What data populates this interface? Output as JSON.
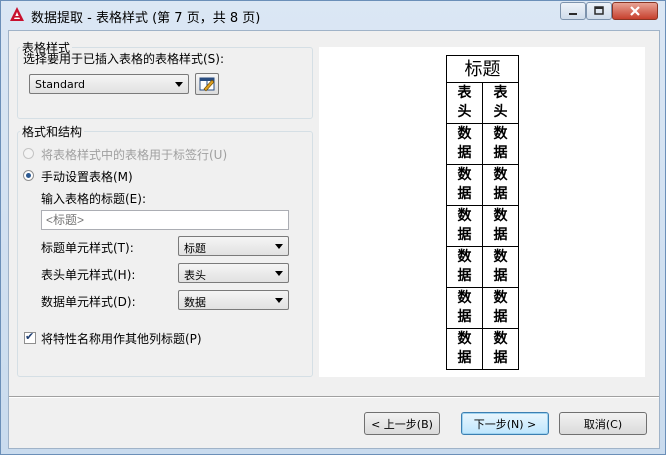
{
  "window": {
    "title": "数据提取 - 表格样式 (第 7 页，共 8 页)"
  },
  "table_style_group": {
    "title": "表格样式",
    "select_label": "选择要用于已插入表格的表格样式(S):",
    "style_value": "Standard"
  },
  "format_group": {
    "title": "格式和结构",
    "radio_label_option": "将表格样式中的表格用于标签行(U)",
    "radio_manual": "手动设置表格(M)",
    "title_input_label": "输入表格的标题(E):",
    "title_input_placeholder": "<标题>",
    "title_cell_label": "标题单元样式(T):",
    "title_cell_value": "标题",
    "header_cell_label": "表头单元样式(H):",
    "header_cell_value": "表头",
    "data_cell_label": "数据单元样式(D):",
    "data_cell_value": "数据",
    "checkbox_label": "将特性名称用作其他列标题(P)"
  },
  "preview": {
    "title": "标题",
    "header_top": "表",
    "header_bottom": "头",
    "data_top": "数",
    "data_bottom": "据"
  },
  "buttons": {
    "back": "< 上一步(B)",
    "next": "下一步(N) >",
    "cancel": "取消(C)"
  }
}
